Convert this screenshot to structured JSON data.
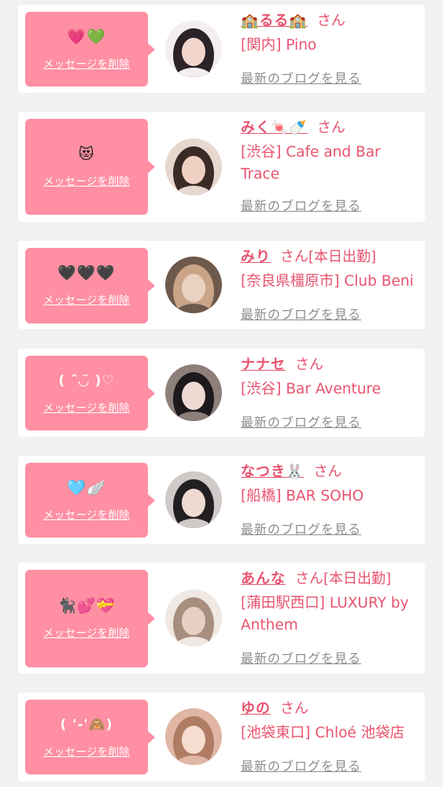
{
  "delete_label": "メッセージを削除",
  "blog_label": "最新のブログを見る",
  "honorific": "さん",
  "entries": [
    {
      "name": "🏫るる🏫",
      "attendance": "",
      "shop": "[関内] Pino",
      "message": "💗💚",
      "kaomoji": false,
      "avatar_colors": [
        "#f4eef0",
        "#2b2328",
        "#f2d6cc"
      ]
    },
    {
      "name": "みく🍬🍼",
      "attendance": "",
      "shop": "[渋谷] Cafe and Bar Trace",
      "message": "😻",
      "kaomoji": false,
      "avatar_colors": [
        "#e8d7cf",
        "#3a2b26",
        "#f1d0c4"
      ]
    },
    {
      "name": "みり",
      "attendance": "[本日出勤]",
      "shop": "[奈良県橿原市] Club Beni",
      "message": "🖤🖤🖤",
      "kaomoji": false,
      "avatar_colors": [
        "#6e5a4c",
        "#c9a487",
        "#ead2c3"
      ]
    },
    {
      "name": "ナナセ",
      "attendance": "",
      "shop": "[渋谷] Bar Aventure",
      "message": "( ˆ◡̈ )♡",
      "kaomoji": true,
      "avatar_colors": [
        "#8d7f7a",
        "#1d1a1d",
        "#eedad2"
      ]
    },
    {
      "name": "なつき🐰",
      "attendance": "",
      "shop": "[船橋] BAR SOHO",
      "message": "🩵🪽",
      "kaomoji": false,
      "avatar_colors": [
        "#cfc9c7",
        "#221f22",
        "#f0dbd2"
      ]
    },
    {
      "name": "あんな",
      "attendance": "[本日出勤]",
      "shop": "[蒲田駅西口] LUXURY by Anthem",
      "message": "🐈‍⬛💕💝",
      "kaomoji": false,
      "avatar_colors": [
        "#efe8e3",
        "#a88e7e",
        "#e9cfc2"
      ]
    },
    {
      "name": "ゆの",
      "attendance": "",
      "shop": "[池袋東口] Chloé 池袋店",
      "message": "( '-'🙈)",
      "kaomoji": true,
      "avatar_colors": [
        "#e0b6a4",
        "#b07c64",
        "#f6ddd0"
      ]
    }
  ]
}
